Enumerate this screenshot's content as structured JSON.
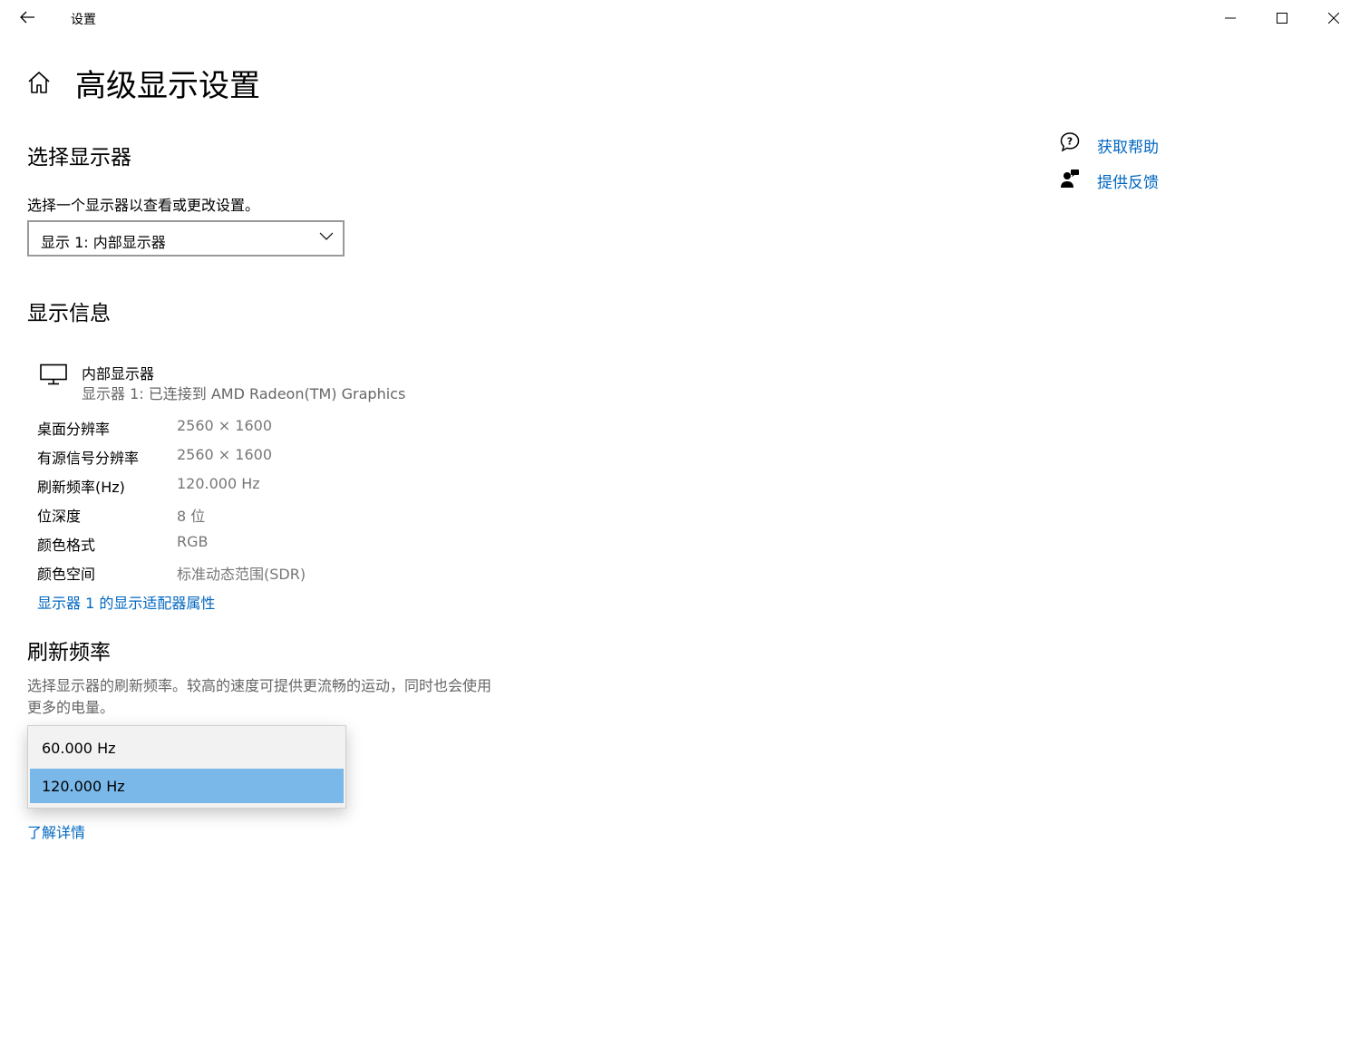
{
  "window": {
    "app_title": "设置"
  },
  "header": {
    "page_title": "高级显示设置"
  },
  "select_display": {
    "heading": "选择显示器",
    "description": "选择一个显示器以查看或更改设置。",
    "selected_value": "显示 1: 内部显示器"
  },
  "display_info": {
    "heading": "显示信息",
    "monitor_name": "内部显示器",
    "monitor_connection": "显示器 1: 已连接到 AMD Radeon(TM) Graphics",
    "rows": [
      {
        "label": "桌面分辨率",
        "value": "2560 × 1600"
      },
      {
        "label": "有源信号分辨率",
        "value": "2560 × 1600"
      },
      {
        "label": "刷新频率(Hz)",
        "value": "120.000 Hz"
      },
      {
        "label": "位深度",
        "value": "8 位"
      },
      {
        "label": "颜色格式",
        "value": "RGB"
      },
      {
        "label": "颜色空间",
        "value": "标准动态范围(SDR)"
      }
    ],
    "adapter_link": "显示器 1 的显示适配器属性"
  },
  "refresh_rate": {
    "heading": "刷新频率",
    "description_line1": "选择显示器的刷新频率。较高的速度可提供更流畅的运动，同时也会使用",
    "description_line2": "更多的电量。",
    "options": [
      "60.000 Hz",
      "120.000 Hz"
    ],
    "selected_option": "120.000 Hz",
    "learn_more": "了解详情"
  },
  "side_links": {
    "get_help": "获取帮助",
    "give_feedback": "提供反馈"
  },
  "colors": {
    "accent_link": "#0067c0",
    "selected_option_bg": "#7ab8ea"
  },
  "icons": {
    "back": "back-arrow-icon",
    "home": "home-icon",
    "minimize": "minimize-icon",
    "maximize": "maximize-icon",
    "close": "close-icon",
    "chevron": "chevron-down-icon",
    "monitor": "monitor-icon",
    "help": "help-chat-icon",
    "feedback": "feedback-person-icon"
  }
}
